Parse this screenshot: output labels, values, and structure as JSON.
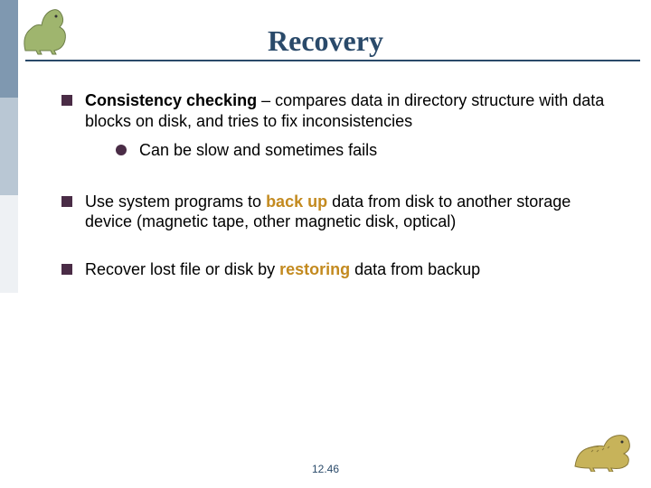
{
  "title": "Recovery",
  "colors": {
    "header_text": "#2a4a6a",
    "rule": "#2a4a6a",
    "square_bullet": "#4a2c46",
    "round_bullet": "#4a2c46",
    "keyword": "#c38a1f",
    "stripe": [
      "#7f98b0",
      "#b9c7d4",
      "#eef1f4",
      "#ffffff",
      "#ffffff"
    ],
    "page_number": "#2a4a6a"
  },
  "icons": {
    "header_dino": "dinosaur-header-icon",
    "footer_dino": "dinosaur-footer-icon"
  },
  "bullets": [
    {
      "runs": [
        {
          "text": "Consistency checking",
          "bold": true
        },
        {
          "text": " – compares data in directory structure with data blocks on disk, and tries to fix inconsistencies"
        }
      ],
      "sub": [
        {
          "runs": [
            {
              "text": "Can be slow and sometimes fails"
            }
          ]
        }
      ]
    },
    {
      "runs": [
        {
          "text": "Use system programs to "
        },
        {
          "text": "back up",
          "bold": true,
          "keyword": true
        },
        {
          "text": " data from disk to another storage device (magnetic tape, other magnetic disk, optical)"
        }
      ]
    },
    {
      "runs": [
        {
          "text": "Recover lost file or disk by "
        },
        {
          "text": "restoring",
          "bold": true,
          "keyword": true
        },
        {
          "text": " data from backup"
        }
      ]
    }
  ],
  "page_number": "12.46"
}
